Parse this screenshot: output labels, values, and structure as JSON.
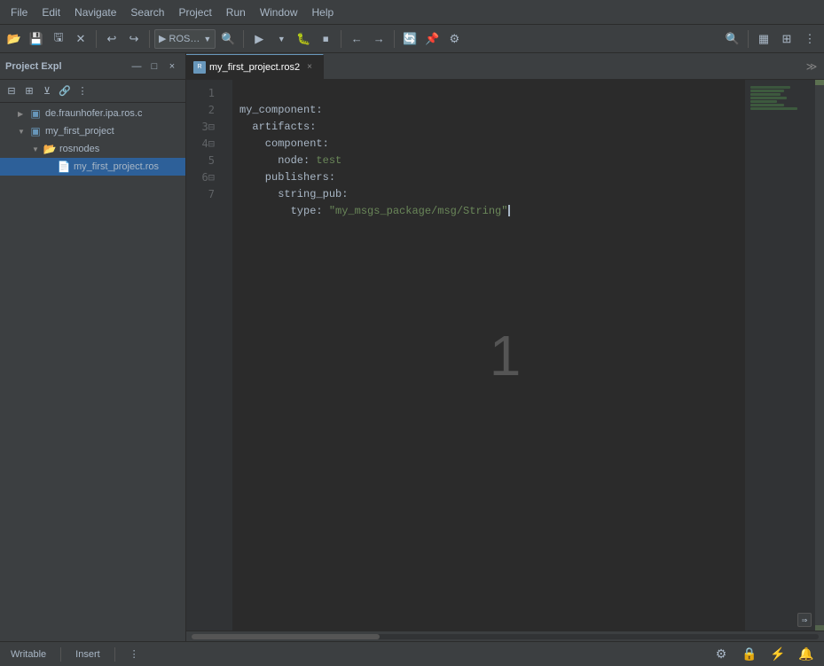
{
  "menubar": {
    "items": [
      "File",
      "Edit",
      "Navigate",
      "Search",
      "Project",
      "Run",
      "Window",
      "Help"
    ]
  },
  "toolbar": {
    "groups": [
      [
        "open-icon",
        "save-icon",
        "save-all-icon",
        "close-icon"
      ],
      [
        "undo-icon",
        "redo-icon"
      ],
      [
        "run-icon",
        "debug-icon",
        "stop-icon"
      ],
      [
        "build-icon",
        "clean-icon"
      ],
      [
        "search-icon",
        "replace-icon"
      ]
    ]
  },
  "sidebar": {
    "title": "Project Expl",
    "tabs_icon": "×",
    "tree": [
      {
        "indent": 0,
        "arrow": "▶",
        "icon": "📁",
        "label": "de.fraunhofer.ipa.ros.c",
        "type": "project"
      },
      {
        "indent": 0,
        "arrow": "▼",
        "icon": "📁",
        "label": "my_first_project",
        "type": "project"
      },
      {
        "indent": 1,
        "arrow": "▼",
        "icon": "📂",
        "label": "rosnodes",
        "type": "folder"
      },
      {
        "indent": 2,
        "arrow": "",
        "icon": "📄",
        "label": "my_first_project.ros",
        "type": "file",
        "selected": true
      }
    ]
  },
  "editor": {
    "tabs": [
      {
        "label": "my_first_project.ros2",
        "icon": "R",
        "active": true,
        "closable": true
      }
    ],
    "lines": [
      {
        "number": "1",
        "content": "my_component:",
        "tokens": [
          {
            "text": "my_component:",
            "class": "yaml-key"
          }
        ]
      },
      {
        "number": "2",
        "content": "  artifacts:",
        "tokens": [
          {
            "text": "  artifacts:",
            "class": "yaml-key"
          }
        ]
      },
      {
        "number": "3",
        "content": "    component:",
        "tokens": [
          {
            "text": "    component:",
            "class": "yaml-key"
          }
        ],
        "folded": true
      },
      {
        "number": "4",
        "content": "      node: test",
        "tokens": [
          {
            "text": "      node: ",
            "class": "yaml-key"
          },
          {
            "text": "test",
            "class": "yaml-value"
          }
        ],
        "folded": true
      },
      {
        "number": "5",
        "content": "    publishers:",
        "tokens": [
          {
            "text": "    publishers:",
            "class": "yaml-key"
          }
        ]
      },
      {
        "number": "6",
        "content": "      string_pub:",
        "tokens": [
          {
            "text": "      string_pub:",
            "class": "yaml-key"
          }
        ],
        "folded": true
      },
      {
        "number": "7",
        "content": "        type: \"my_msgs_package/msg/String\"",
        "tokens": [
          {
            "text": "        type: ",
            "class": "yaml-key"
          },
          {
            "text": "\"my_msgs_package/msg/String\"",
            "class": "yaml-string"
          }
        ]
      }
    ],
    "center_number": "1"
  },
  "statusbar": {
    "left": {
      "mode": "Writable",
      "insert": "Insert",
      "menu_dots": "⋮"
    },
    "right": {
      "icons": [
        "⚙",
        "🔒",
        "⚡",
        "🔔"
      ]
    }
  }
}
